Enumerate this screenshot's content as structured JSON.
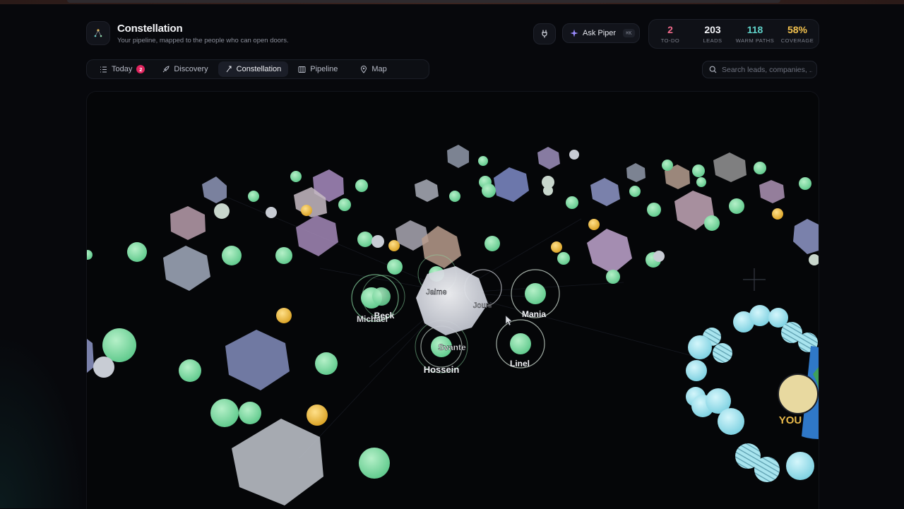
{
  "app": {
    "title": "Constellation",
    "subtitle": "Your pipeline, mapped to the people who can open doors."
  },
  "header": {
    "ask_label": "Ask Piper",
    "ask_shortcut": "⌘K",
    "stats": [
      {
        "value": "2",
        "label": "TO-DO",
        "color": "#f06a8a"
      },
      {
        "value": "203",
        "label": "LEADS",
        "color": "#f2f3f7"
      },
      {
        "value": "118",
        "label": "WARM PATHS",
        "color": "#5fd1c8"
      },
      {
        "value": "58%",
        "label": "COVERAGE",
        "color": "#f2c14e"
      }
    ]
  },
  "nav": {
    "tabs": [
      {
        "label": "Today",
        "icon": "list-icon",
        "badge": "2"
      },
      {
        "label": "Discovery",
        "icon": "rocket-icon"
      },
      {
        "label": "Constellation",
        "icon": "sparkle-icon",
        "active": true
      },
      {
        "label": "Pipeline",
        "icon": "columns-icon"
      },
      {
        "label": "Map",
        "icon": "pin-icon"
      }
    ]
  },
  "search": {
    "placeholder": "Search leads, companies, ..."
  },
  "graph": {
    "nodes": [
      {
        "label": "Jaime"
      },
      {
        "label": "Jouni"
      },
      {
        "label": "Mania"
      },
      {
        "label": "Beck"
      },
      {
        "label": "Michael"
      },
      {
        "label": "Svante"
      },
      {
        "label": "Hossein"
      },
      {
        "label": "Linel"
      }
    ],
    "you_label": "YOU"
  },
  "colors": {
    "background": "#07080c",
    "node_green": "#8fe0a8",
    "node_gold": "#f0c24a",
    "node_cyan": "#9fe3ee",
    "company_purple": "#a58ab8",
    "company_gray": "#9aa3b5"
  }
}
